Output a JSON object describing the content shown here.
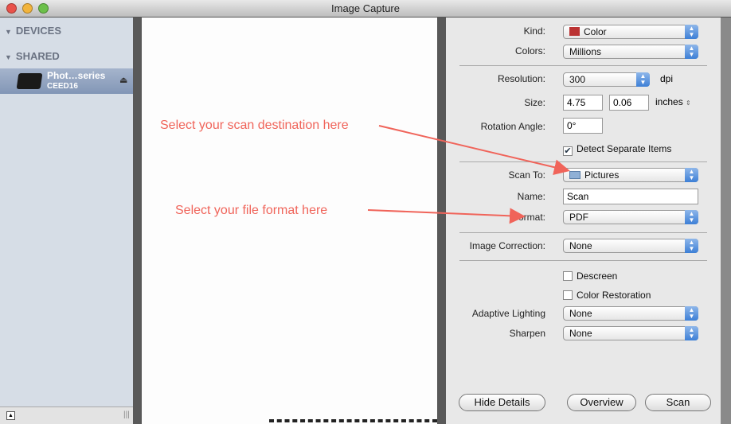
{
  "window": {
    "title": "Image Capture"
  },
  "sidebar": {
    "devices": "DEVICES",
    "shared": "SHARED",
    "device_name": "Phot…series",
    "device_sub": "CEED16"
  },
  "settings": {
    "kind_label": "Kind:",
    "kind": "Color",
    "colors_label": "Colors:",
    "colors": "Millions",
    "resolution_label": "Resolution:",
    "resolution": "300",
    "dpi": "dpi",
    "size_label": "Size:",
    "width": "4.75",
    "height": "0.06",
    "units": "inches",
    "rotation_label": "Rotation Angle:",
    "rotation": "0°",
    "detect": "Detect Separate Items",
    "detect_checked": true,
    "scanto_label": "Scan To:",
    "scanto": "Pictures",
    "name_label": "Name:",
    "name": "Scan",
    "format_label": "Format:",
    "format": "PDF",
    "correction_label": "Image Correction:",
    "correction": "None",
    "descreen": "Descreen",
    "color_restoration": "Color Restoration",
    "adaptive_label": "Adaptive Lighting",
    "adaptive": "None",
    "sharpen_label": "Sharpen",
    "sharpen": "None"
  },
  "buttons": {
    "hide": "Hide Details",
    "overview": "Overview",
    "scan": "Scan"
  },
  "annotations": {
    "dest": "Select your scan destination here",
    "format": "Select your file format here"
  },
  "colors": {
    "annotation": "#f0645a"
  }
}
